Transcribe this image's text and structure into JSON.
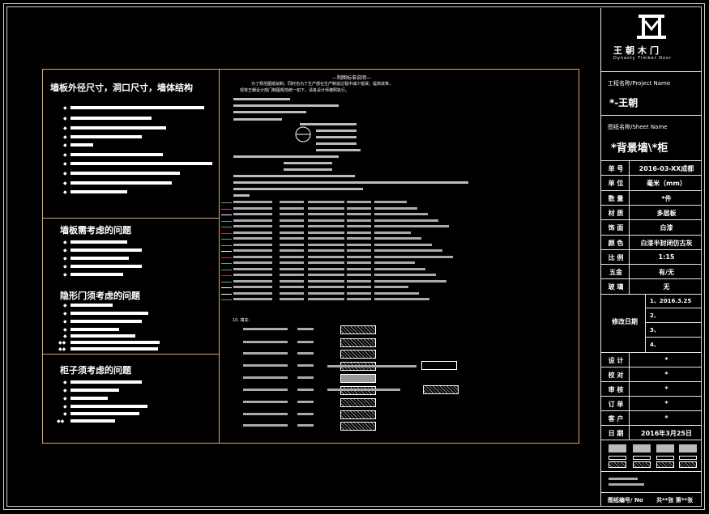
{
  "colors": {
    "frame": "#cfcfcf",
    "sheet_border": "#d9a86b",
    "background": "#000000",
    "text": "#ffffff",
    "accent_line": "#5aa0a0",
    "magenta": "#b44bb4",
    "red": "#c03030"
  },
  "left": {
    "section1_title": "墙板外径尺寸，洞口尺寸，墙体结构",
    "section2_title": "墙板需考虑的问题",
    "section3_title": "隐形门须考虑的问题",
    "section4_title": "柜子须考虑的问题"
  },
  "middle": {
    "title": "—制图标准说明—",
    "intro1": "为了规范图纸绘制，同时也为了生产部在生产制造过程中减少错误，提高效率，",
    "intro2": "现将王朝设计部门制图规范统一如下，请各设计师遵照执行。",
    "hatch_heading": "10. 填充:"
  },
  "title_block": {
    "logo_text": "王朝木门",
    "logo_sub": "Dynasty Timber Door",
    "project_label": "工程名称/Project Name",
    "project_name": "*-王朝",
    "drawing_label": "图纸名称/Sheet Name",
    "drawing_name": "*背景墙\\*柜",
    "rows": [
      {
        "label": "单 号",
        "value": "2016-03-XX成都"
      },
      {
        "label": "单 位",
        "value": "毫米（mm）"
      },
      {
        "label": "数 量",
        "value": "*件"
      },
      {
        "label": "材 质",
        "value": "多层板"
      },
      {
        "label": "饰 面",
        "value": "白漆"
      },
      {
        "label": "颜 色",
        "value": "白漆半封闭仿古灰"
      },
      {
        "label": "比 例",
        "value": "1:15"
      },
      {
        "label": "五金",
        "value": "有/无"
      },
      {
        "label": "玻 璃",
        "value": "无"
      }
    ],
    "revision_label": "修改日期",
    "revisions": [
      "1、2016.3.25",
      "2、",
      "3、",
      "4、"
    ],
    "rows2": [
      {
        "label": "设 计",
        "value": "*"
      },
      {
        "label": "校 对",
        "value": "*"
      },
      {
        "label": "审 核",
        "value": "*"
      },
      {
        "label": "订 单",
        "value": "*"
      },
      {
        "label": "客 户",
        "value": "*"
      },
      {
        "label": "日 期",
        "value": "2016年3月25日"
      }
    ],
    "sheet_no_label": "图纸编号/ No",
    "sheet_no_value": "共**张 第**张"
  }
}
